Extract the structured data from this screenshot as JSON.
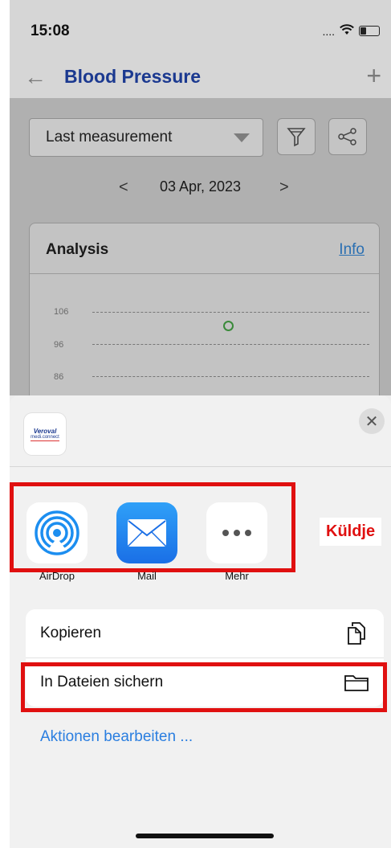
{
  "status_bar": {
    "time": "15:08",
    "signal": "....",
    "wifi_icon": "wifi-icon",
    "battery_icon": "battery-icon"
  },
  "header": {
    "title": "Blood Pressure",
    "back_icon": "arrow-left-icon",
    "add_icon": "plus-icon"
  },
  "filters": {
    "dropdown_value": "Last measurement",
    "filter_icon": "filter-icon",
    "share_icon": "share-icon"
  },
  "date_nav": {
    "date": "03 Apr, 2023",
    "prev": "<",
    "next": ">"
  },
  "analysis": {
    "title": "Analysis",
    "info_link": "Info",
    "y_ticks": [
      "106",
      "96",
      "86"
    ],
    "point_value": 101
  },
  "share_sheet": {
    "app_logo": {
      "line1": "Veroval",
      "line2": "medi.connect"
    },
    "close_icon": "close-icon",
    "apps": [
      {
        "label": "AirDrop",
        "icon": "airdrop-icon"
      },
      {
        "label": "Mail",
        "icon": "mail-icon"
      },
      {
        "label": "Mehr",
        "icon": "more-icon"
      }
    ],
    "actions": [
      {
        "label": "Kopieren",
        "icon": "copy-icon"
      },
      {
        "label": "In Dateien sichern",
        "icon": "folder-icon"
      }
    ],
    "edit_actions": "Aktionen bearbeiten ...",
    "annotation": "Küldje"
  },
  "colors": {
    "accent_blue": "#1b3990",
    "highlight_red": "#e01010",
    "link_blue": "#2a7ee0"
  }
}
